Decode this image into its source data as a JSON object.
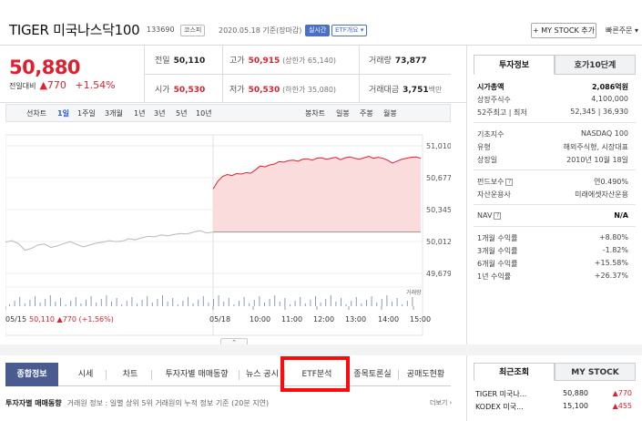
{
  "header": {
    "name": "TIGER 미국나스닥100",
    "code": "133690",
    "market_tag": "코스피",
    "date_text": "2020.05.18 기준(장마감)",
    "realtime_tag": "실시간",
    "etf_tag": "ETF개요 ▾",
    "mystock_button": "+ MY STOCK 추가",
    "quick_order": "빠른주문 ▾"
  },
  "price": {
    "current": "50,880",
    "change_label": "전일대비",
    "change_arrow": "▲",
    "change_value": "770",
    "change_pct": "+1.54%"
  },
  "stats": {
    "prev_label": "전일",
    "prev_value": "50,110",
    "high_label": "고가",
    "high_value": "50,915",
    "high_sub": "(상한가 65,140)",
    "volume_label": "거래량",
    "volume_value": "73,877",
    "open_label": "시가",
    "open_value": "50,530",
    "low_label": "저가",
    "low_value": "50,530",
    "low_sub": "(하한가 35,080)",
    "amount_label": "거래대금",
    "amount_value": "3,751",
    "amount_unit": "백만"
  },
  "range_bar": {
    "line_label": "선차트",
    "ranges": [
      "1일",
      "1주일",
      "3개월",
      "1년",
      "3년",
      "5년",
      "10년"
    ],
    "candle_label": "봉차트",
    "candles": [
      "일봉",
      "주봉",
      "월봉"
    ]
  },
  "chart_data": {
    "type": "line",
    "y_ticks": [
      "51,010",
      "50,677",
      "50,345",
      "50,012",
      "49,679"
    ],
    "ylim": [
      49679,
      51010
    ],
    "baseline": 50110,
    "volume_label": "거래량",
    "x_ticks": [
      "05/15",
      "05/18",
      "10:00",
      "11:00",
      "12:00",
      "13:00",
      "14:00",
      "15:00"
    ],
    "bottom_info": {
      "date": "05/15",
      "price": "50,110",
      "arrow": "▲",
      "change": "770",
      "pct": "(+1.56%)"
    },
    "prev_day_series": [
      50005,
      50020,
      49990,
      49920,
      49940,
      49975,
      49985,
      49950,
      49965,
      49990,
      50010,
      49980,
      49955,
      49975,
      49995,
      50005,
      50020,
      50010,
      50015,
      50040,
      50030,
      50050,
      50065,
      50060,
      50080,
      50070,
      50085,
      50095,
      50090,
      50110,
      50125,
      50100,
      50110
    ],
    "today_series": [
      50560,
      50640,
      50690,
      50710,
      50700,
      50720,
      50715,
      50730,
      50725,
      50760,
      50800,
      50790,
      50810,
      50820,
      50845,
      50840,
      50855,
      50860,
      50850,
      50870,
      50875,
      50860,
      50880,
      50885,
      50870,
      50880,
      50890,
      50865,
      50885,
      50895,
      50880,
      50870,
      50885,
      50900,
      50880,
      50890,
      50880,
      50860,
      50830,
      50850,
      50870,
      50880,
      50890,
      50895,
      50880
    ]
  },
  "toggle_text": "⌃",
  "tabs": [
    "종합정보",
    "시세",
    "차트",
    "투자자별 매매동향",
    "뉴스 공시",
    "ETF분석",
    "종목토론실",
    "공매도현황"
  ],
  "investor": {
    "title": "투자자별 매매동향",
    "desc": "거래원 정보 : 일별 상위 5위 거래원의 누적 정보 기준 (20분 지연)",
    "more": "더보기 ›"
  },
  "side": {
    "tab_info": "투자정보",
    "tab_quote": "호가10단계",
    "rows_a": [
      {
        "k": "시가총액",
        "v": "2,086억원",
        "bold": true
      },
      {
        "k": "상장주식수",
        "v": "4,100,000"
      },
      {
        "k": "52주최고 | 최저",
        "v": "52,345 | 36,930"
      }
    ],
    "rows_b": [
      {
        "k": "기초지수",
        "v": "NASDAQ 100"
      },
      {
        "k": "유형",
        "v": "해외주식형, 시장대표"
      },
      {
        "k": "상장일",
        "v": "2010년 10월 18일"
      }
    ],
    "rows_c": [
      {
        "k": "펀드보수",
        "v": "연0.490%"
      },
      {
        "k": "자산운용사",
        "v": "미래에셋자산운용"
      }
    ],
    "nav_label": "NAV",
    "nav_value": "N/A",
    "returns": [
      {
        "k": "1개월 수익률",
        "v": "+8.80%",
        "color": "#e0202e"
      },
      {
        "k": "3개월 수익률",
        "v": "-1.82%",
        "color": "#2a5bd7"
      },
      {
        "k": "6개월 수익률",
        "v": "+15.58%",
        "color": "#e0202e"
      },
      {
        "k": "1년 수익률",
        "v": "+26.37%",
        "color": "#e0202e"
      }
    ]
  },
  "recent": {
    "tab_recent": "최근조회",
    "tab_mystock": "MY STOCK",
    "items": [
      {
        "name": "TIGER 미국나...",
        "price": "50,880",
        "change": "▲770"
      },
      {
        "name": "KODEX 미국...",
        "price": "15,100",
        "change": "▲455"
      }
    ]
  }
}
